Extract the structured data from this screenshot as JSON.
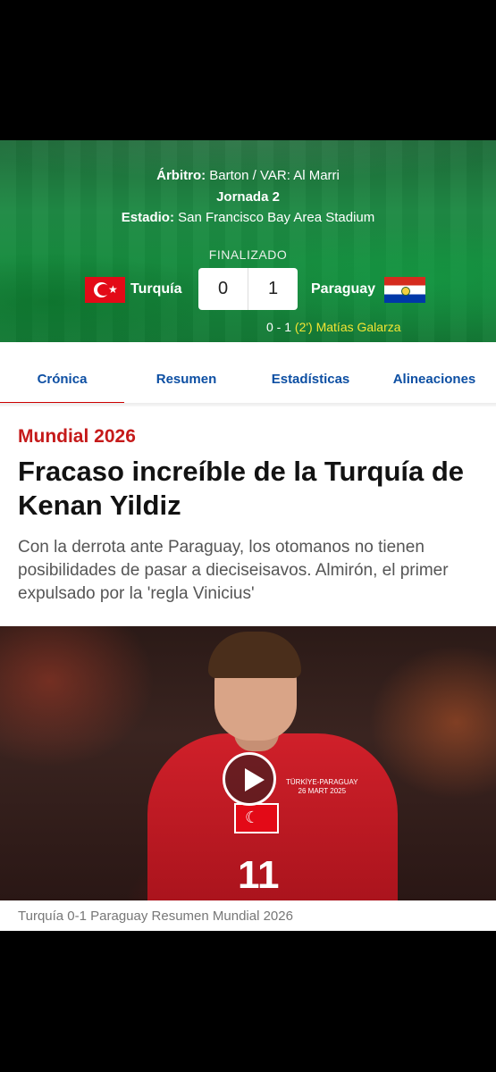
{
  "match": {
    "referee_label": "Árbitro:",
    "referee_value": "Barton / VAR: Al Marri",
    "round": "Jornada 2",
    "stadium_label": "Estadio:",
    "stadium_value": "San Francisco Bay Area Stadium",
    "status": "FINALIZADO",
    "home_team": "Turquía",
    "away_team": "Paraguay",
    "home_score": "0",
    "away_score": "1",
    "goal_score": "0 - 1",
    "goal_minute": "(2')",
    "goal_scorer": "Matías Galarza"
  },
  "tabs": [
    {
      "label": "Crónica",
      "active": true
    },
    {
      "label": "Resumen",
      "active": false
    },
    {
      "label": "Estadísticas",
      "active": false
    },
    {
      "label": "Alineaciones",
      "active": false
    }
  ],
  "article": {
    "category": "Mundial 2026",
    "headline": "Fracaso increíble de la Turquía de Kenan Yildiz",
    "standfirst": "Con la derrota ante Paraguay, los otomanos no tienen posibilidades de pasar a dieciseisavos. Almirón, el primer expulsado por la 'regla Vinicius'",
    "video_caption": "Turquía 0-1 Paraguay Resumen Mundial 2026",
    "shirt_number": "11",
    "shirt_crest_line1": "TÜRKİYE-PARAGUAY",
    "shirt_crest_line2": "26 MART 2025"
  },
  "colors": {
    "accent_red": "#c51a1a",
    "tab_blue": "#0d4fa3",
    "goal_yellow": "#f3e533"
  }
}
